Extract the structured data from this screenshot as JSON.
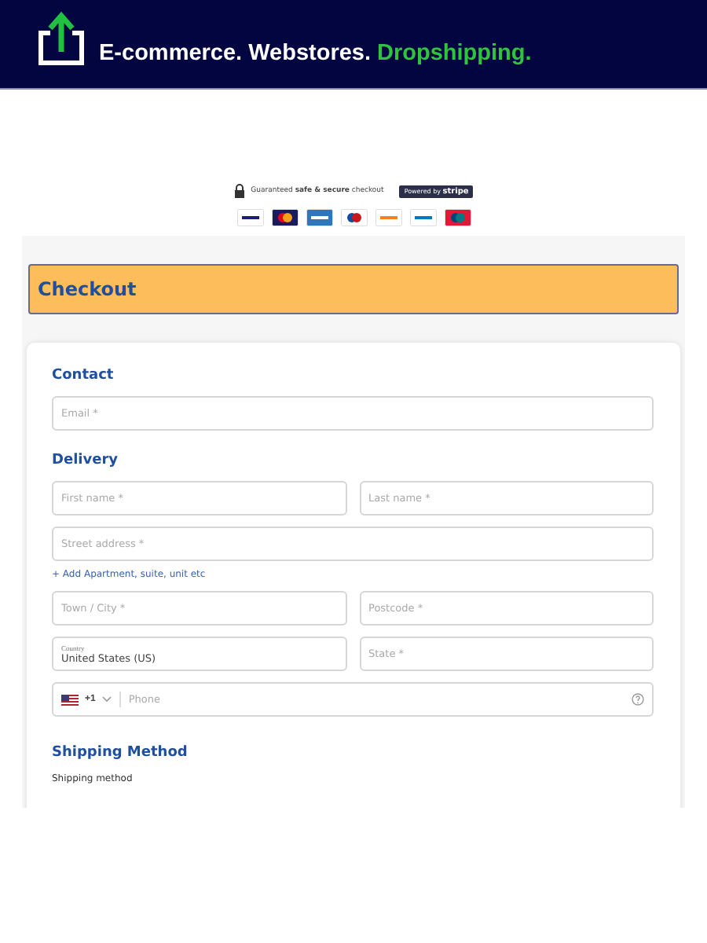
{
  "banner": {
    "text": "E-commerce. Webstores.",
    "highlight": "Dropshipping."
  },
  "secure": {
    "text": "Guaranteed **safe & secure** checkout",
    "badge_small": "Powered by",
    "badge_brand": "stripe"
  },
  "payment_cards": [
    {
      "kind": "visa"
    },
    {
      "kind": "mastercard"
    },
    {
      "kind": "amex"
    },
    {
      "kind": "jcb"
    },
    {
      "kind": "discover"
    },
    {
      "kind": "diners"
    },
    {
      "kind": "unionpay"
    }
  ],
  "checkout_title": "Checkout",
  "contact": {
    "heading": "Contact",
    "email_placeholder": "Email *"
  },
  "delivery": {
    "heading": "Delivery",
    "first_name_placeholder": "First name *",
    "last_name_placeholder": "Last name *",
    "street_placeholder": "Street address *",
    "add_link": "+ Add Apartment, suite, unit etc",
    "city_placeholder": "Town / City *",
    "postcode_placeholder": "Postcode *",
    "country_label": "Country",
    "country_value": "United States (US)",
    "state_placeholder": "State *",
    "phone_code": "+1",
    "phone_placeholder": "Phone"
  },
  "shipping": {
    "heading": "Shipping Method",
    "label": "Shipping method"
  }
}
